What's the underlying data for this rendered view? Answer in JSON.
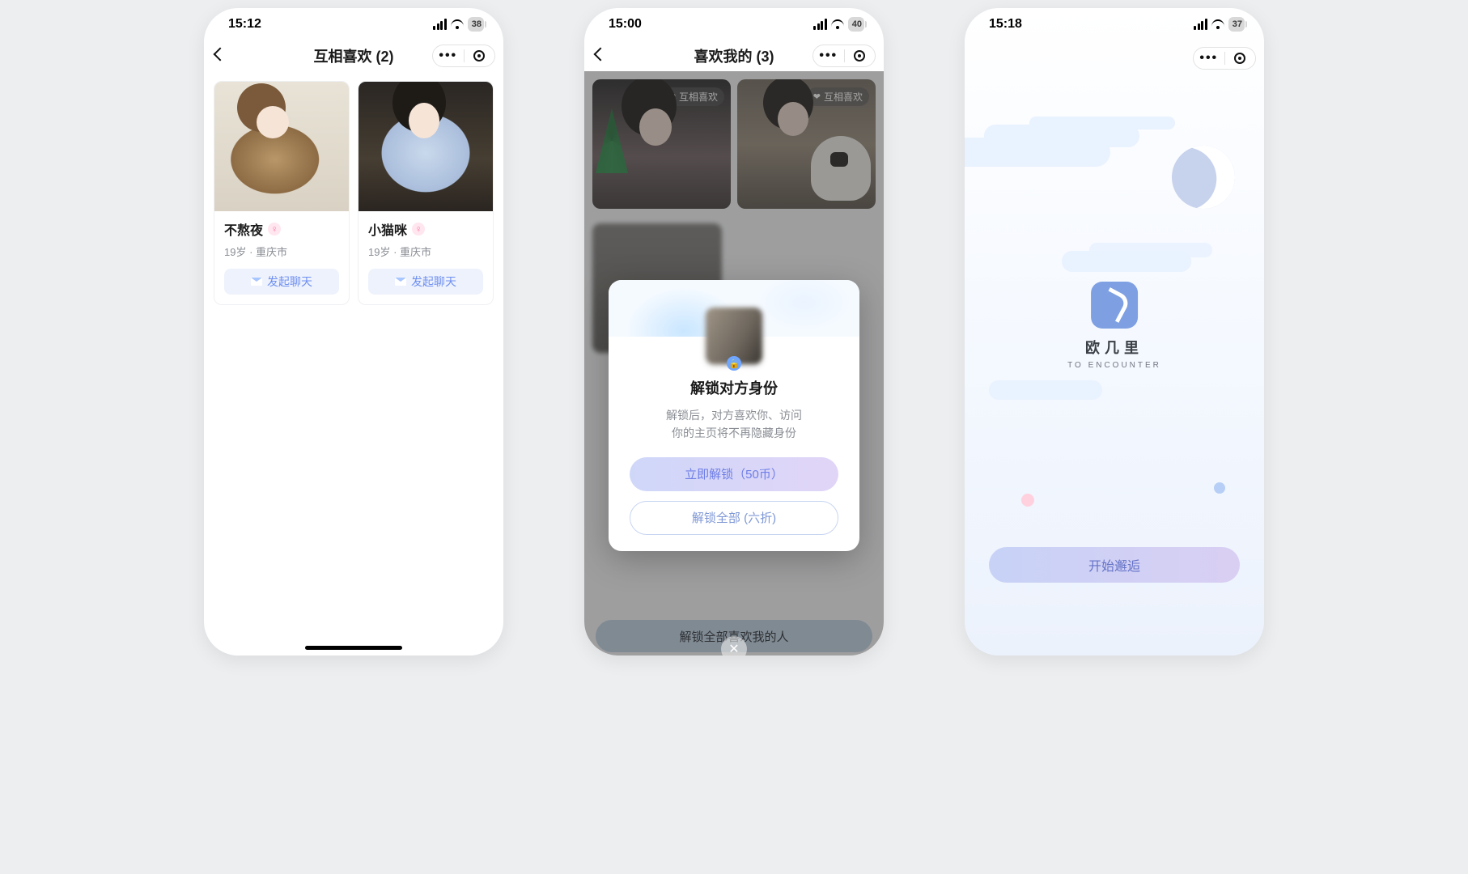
{
  "screens": [
    {
      "status": {
        "time": "15:12",
        "battery": "38"
      },
      "nav": {
        "title": "互相喜欢 (2)"
      },
      "cards": [
        {
          "name": "不熬夜",
          "sub": "19岁 · 重庆市",
          "chat": "发起聊天"
        },
        {
          "name": "小猫咪",
          "sub": "19岁 · 重庆市",
          "chat": "发起聊天"
        }
      ]
    },
    {
      "status": {
        "time": "15:00",
        "battery": "40"
      },
      "nav": {
        "title": "喜欢我的 (3)"
      },
      "mutual_chip": "互相喜欢",
      "bottom_pill": "解锁全部喜欢我的人",
      "modal": {
        "title": "解锁对方身份",
        "desc1": "解锁后，对方喜欢你、访问",
        "desc2": "你的主页将不再隐藏身份",
        "primary": "立即解锁（50币）",
        "outline": "解锁全部 (六折)"
      }
    },
    {
      "status": {
        "time": "15:18",
        "battery": "37"
      },
      "brand": {
        "name": "欧几里",
        "tag": "TO ENCOUNTER"
      },
      "start": "开始邂逅"
    }
  ]
}
